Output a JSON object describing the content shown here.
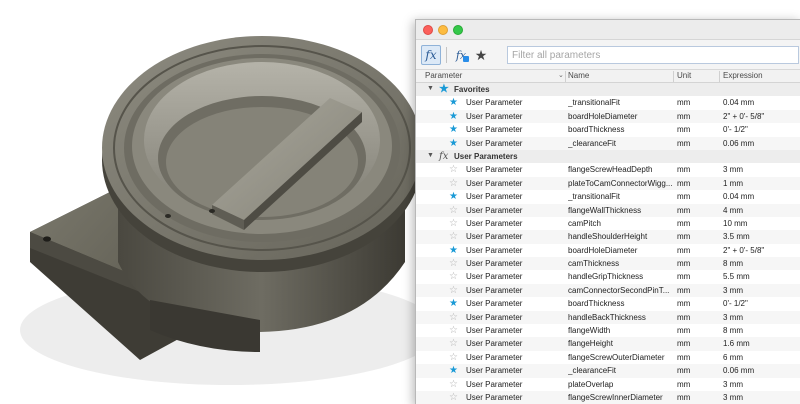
{
  "toolbar": {
    "fx_icon": "fx-icon",
    "fx2_icon": "fx-favorite-filter-icon",
    "star_icon": "star-icon",
    "search_placeholder": "Filter all parameters"
  },
  "columns": {
    "parameter": "Parameter",
    "name": "Name",
    "unit": "Unit",
    "expression": "Expression"
  },
  "groups": {
    "favorites": "Favorites",
    "user_parameters": "User Parameters"
  },
  "favorites": [
    {
      "type": "User Parameter",
      "name": "_transitionalFit",
      "unit": "mm",
      "expr": "0.04 mm",
      "fav": true
    },
    {
      "type": "User Parameter",
      "name": "boardHoleDiameter",
      "unit": "mm",
      "expr": "2\" + 0'- 5/8\"",
      "fav": true
    },
    {
      "type": "User Parameter",
      "name": "boardThickness",
      "unit": "mm",
      "expr": "0'- 1/2\"",
      "fav": true
    },
    {
      "type": "User Parameter",
      "name": "_clearanceFit",
      "unit": "mm",
      "expr": "0.06 mm",
      "fav": true
    }
  ],
  "user_params": [
    {
      "type": "User Parameter",
      "name": "flangeScrewHeadDepth",
      "unit": "mm",
      "expr": "3 mm",
      "fav": false
    },
    {
      "type": "User Parameter",
      "name": "plateToCamConnectorWigg...",
      "unit": "mm",
      "expr": "1 mm",
      "fav": false
    },
    {
      "type": "User Parameter",
      "name": "_transitionalFit",
      "unit": "mm",
      "expr": "0.04 mm",
      "fav": true
    },
    {
      "type": "User Parameter",
      "name": "flangeWallThickness",
      "unit": "mm",
      "expr": "4 mm",
      "fav": false
    },
    {
      "type": "User Parameter",
      "name": "camPitch",
      "unit": "mm",
      "expr": "10 mm",
      "fav": false
    },
    {
      "type": "User Parameter",
      "name": "handleShoulderHeight",
      "unit": "mm",
      "expr": "3.5 mm",
      "fav": false
    },
    {
      "type": "User Parameter",
      "name": "boardHoleDiameter",
      "unit": "mm",
      "expr": "2\" + 0'- 5/8\"",
      "fav": true
    },
    {
      "type": "User Parameter",
      "name": "camThickness",
      "unit": "mm",
      "expr": "8 mm",
      "fav": false
    },
    {
      "type": "User Parameter",
      "name": "handleGripThickness",
      "unit": "mm",
      "expr": "5.5 mm",
      "fav": false
    },
    {
      "type": "User Parameter",
      "name": "camConnectorSecondPinT...",
      "unit": "mm",
      "expr": "3 mm",
      "fav": false
    },
    {
      "type": "User Parameter",
      "name": "boardThickness",
      "unit": "mm",
      "expr": "0'- 1/2\"",
      "fav": true
    },
    {
      "type": "User Parameter",
      "name": "handleBackThickness",
      "unit": "mm",
      "expr": "3 mm",
      "fav": false
    },
    {
      "type": "User Parameter",
      "name": "flangeWidth",
      "unit": "mm",
      "expr": "8 mm",
      "fav": false
    },
    {
      "type": "User Parameter",
      "name": "flangeHeight",
      "unit": "mm",
      "expr": "1.6 mm",
      "fav": false
    },
    {
      "type": "User Parameter",
      "name": "flangeScrewOuterDiameter",
      "unit": "mm",
      "expr": "6 mm",
      "fav": false
    },
    {
      "type": "User Parameter",
      "name": "_clearanceFit",
      "unit": "mm",
      "expr": "0.06 mm",
      "fav": true
    },
    {
      "type": "User Parameter",
      "name": "plateOverlap",
      "unit": "mm",
      "expr": "3 mm",
      "fav": false
    },
    {
      "type": "User Parameter",
      "name": "flangeScrewInnerDiameter",
      "unit": "mm",
      "expr": "3 mm",
      "fav": false
    }
  ]
}
